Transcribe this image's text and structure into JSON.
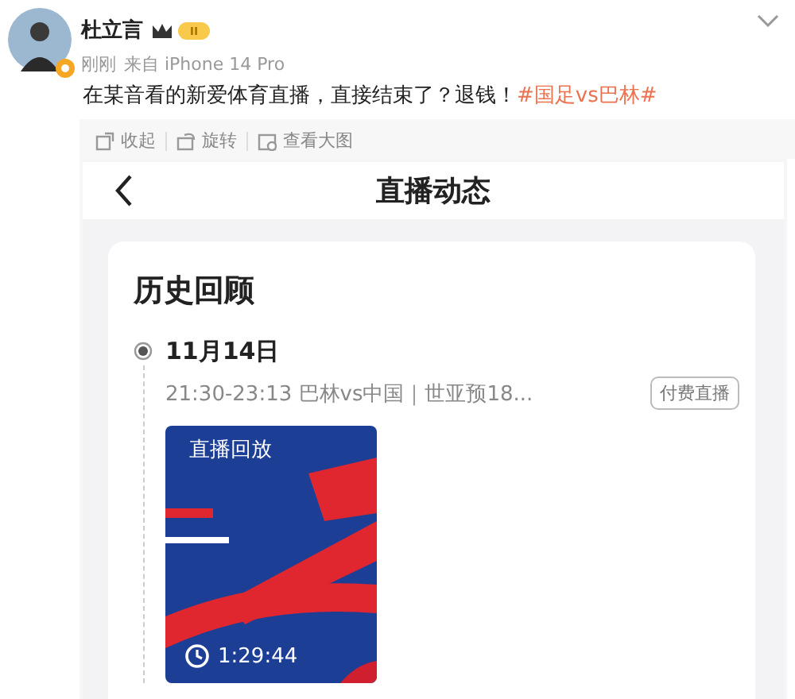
{
  "post": {
    "author": "杜立言",
    "time": "刚刚",
    "source": "来自 iPhone 14 Pro",
    "text": "在某音看的新爱体育直播，直接结束了？退钱！",
    "hashtag": "#国足vs巴林#"
  },
  "actions": [
    {
      "kind": "collapse",
      "label": "收起"
    },
    {
      "kind": "rotate",
      "label": "旋转"
    },
    {
      "kind": "zoom",
      "label": "查看大图"
    }
  ],
  "image": {
    "title": "直播动态",
    "section": "历史回顾",
    "entries": [
      {
        "date": "11月14日",
        "detail": "21:30-23:13 巴林vs中国｜世亚预18...",
        "tag": "付费直播",
        "video": {
          "badge": "直播回放",
          "duration": "1:29:44"
        }
      }
    ]
  }
}
